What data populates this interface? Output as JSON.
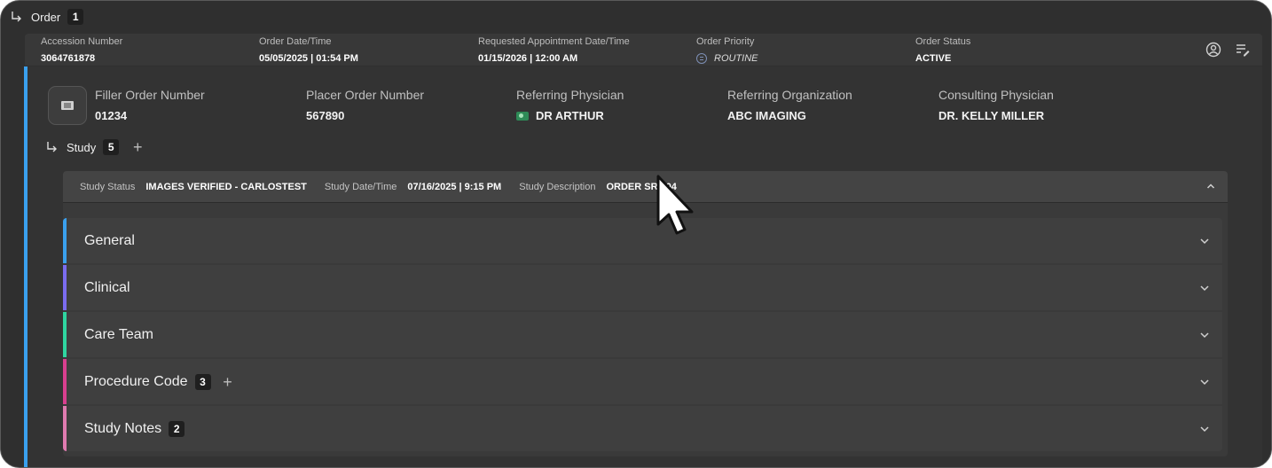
{
  "order": {
    "label": "Order",
    "count": "1"
  },
  "summary": {
    "accession": {
      "label": "Accession Number",
      "value": "3064761878"
    },
    "order_datetime": {
      "label": "Order Date/Time",
      "value": "05/05/2025 | 01:54 PM"
    },
    "requested_appt": {
      "label": "Requested Appointment Date/Time",
      "value": "01/15/2026 | 12:00 AM"
    },
    "priority": {
      "label": "Order Priority",
      "value": "ROUTINE"
    },
    "status": {
      "label": "Order Status",
      "value": "ACTIVE"
    },
    "icons": [
      "user-circle-icon",
      "edit-list-icon"
    ]
  },
  "detail": {
    "filler": {
      "label": "Filler Order Number",
      "value": "01234"
    },
    "placer": {
      "label": "Placer Order Number",
      "value": "567890"
    },
    "referring_physician": {
      "label": "Referring Physician",
      "value": "DR ARTHUR"
    },
    "referring_org": {
      "label": "Referring Organization",
      "value": "ABC IMAGING"
    },
    "consulting_physician": {
      "label": "Consulting Physician",
      "value": "DR. KELLY MILLER"
    }
  },
  "study": {
    "label": "Study",
    "count": "5",
    "status_label": "Study Status",
    "status_value": "IMAGES VERIFIED - CARLOSTEST",
    "datetime_label": "Study Date/Time",
    "datetime_value": "07/16/2025 | 9:15 PM",
    "desc_label": "Study Description",
    "desc_value": "ORDER SR 004"
  },
  "sections": [
    {
      "title": "General",
      "accent": "#3aa0ee"
    },
    {
      "title": "Clinical",
      "accent": "#7b6cf0"
    },
    {
      "title": "Care Team",
      "accent": "#2fd6a0"
    },
    {
      "title": "Procedure Code",
      "count": "3",
      "accent": "#d93f8f"
    },
    {
      "title": "Study Notes",
      "count": "2",
      "accent": "#e07bb0"
    }
  ]
}
